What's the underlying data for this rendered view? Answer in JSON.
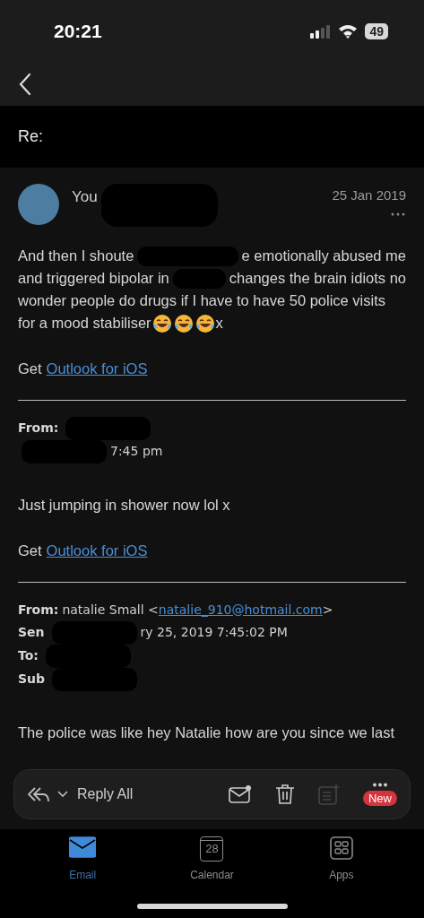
{
  "status_bar": {
    "time": "20:21",
    "battery": "49"
  },
  "subject": "Re:",
  "message": {
    "sender": "You",
    "date": "25 Jan 2019",
    "body": [
      {
        "segments": [
          {
            "kind": "text",
            "text": "And then I shoute"
          },
          {
            "kind": "redaction"
          },
          {
            "kind": "text",
            "text": "e emotionally abused me"
          }
        ]
      },
      {
        "segments": [
          {
            "kind": "text",
            "text": "and triggered bipolar in"
          },
          {
            "kind": "redaction"
          },
          {
            "kind": "text",
            "text": "changes the brain idiots no"
          }
        ]
      },
      {
        "segments": [
          {
            "kind": "text",
            "text": "wonder people do drugs if I have to have 50 police visits"
          }
        ]
      },
      {
        "segments": [
          {
            "kind": "text",
            "text": "for a mood stabiliser"
          },
          {
            "kind": "emoji"
          },
          {
            "kind": "emoji"
          },
          {
            "kind": "emoji"
          },
          {
            "kind": "text",
            "text": "x"
          }
        ]
      }
    ],
    "signature": {
      "prefix": "Get",
      "link": "Outlook for iOS"
    }
  },
  "quotes": [
    {
      "headers": [
        {
          "segments": [
            {
              "kind": "label",
              "text": "From:"
            },
            {
              "kind": "redaction"
            }
          ]
        },
        {
          "segments": [
            {
              "kind": "redaction"
            },
            {
              "kind": "text",
              "text": "7:45 pm"
            }
          ]
        }
      ],
      "body": "Just jumping in shower now lol x",
      "signature": {
        "prefix": "Get",
        "link": "Outlook for iOS"
      }
    },
    {
      "headers": [
        {
          "segments": [
            {
              "kind": "label",
              "text": "From:"
            },
            {
              "kind": "text",
              "text": "natalie Small <"
            },
            {
              "kind": "link",
              "text": "natalie_910@hotmail.com"
            },
            {
              "kind": "text",
              "text": ">"
            }
          ]
        },
        {
          "segments": [
            {
              "kind": "label",
              "text": "Sen"
            },
            {
              "kind": "redaction"
            },
            {
              "kind": "text",
              "text": "ry 25, 2019 7:45:02 PM"
            }
          ]
        },
        {
          "segments": [
            {
              "kind": "label",
              "text": "To:"
            },
            {
              "kind": "redaction"
            }
          ]
        },
        {
          "segments": [
            {
              "kind": "label",
              "text": "Sub"
            },
            {
              "kind": "redaction"
            }
          ]
        }
      ],
      "body": "The police was like hey Natalie how are you since we last"
    }
  ],
  "toolbar": {
    "reply": "Reply All",
    "more_badge": "New"
  },
  "tabs": [
    {
      "label": "Email",
      "selected": true
    },
    {
      "label": "Calendar",
      "selected": false,
      "day": "28"
    },
    {
      "label": "Apps",
      "selected": false
    }
  ]
}
